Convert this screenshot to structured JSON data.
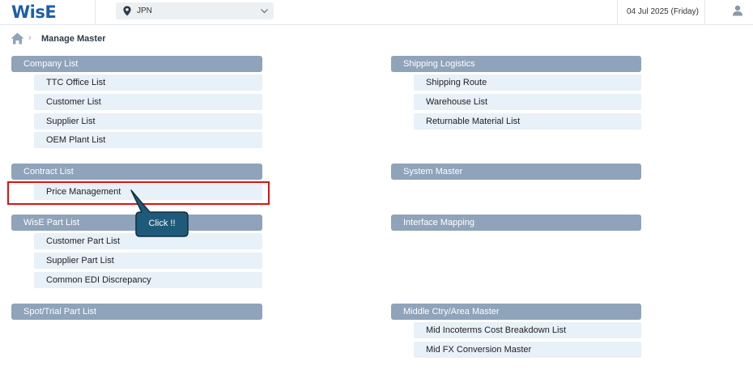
{
  "header": {
    "logo": "WisE",
    "country": "JPN",
    "date": "04 Jul 2025 (Friday)"
  },
  "breadcrumb": {
    "title": "Manage Master"
  },
  "groups": {
    "company_list": {
      "title": "Company List",
      "items": [
        "TTC Office List",
        "Customer List",
        "Supplier List",
        "OEM Plant List"
      ]
    },
    "contract_list": {
      "title": "Contract List",
      "items": [
        "Price Management"
      ]
    },
    "wise_part_list": {
      "title": "WisE Part List",
      "items": [
        "Customer Part List",
        "Supplier Part List",
        "Common EDI Discrepancy"
      ]
    },
    "spot_trial_part_list": {
      "title": "Spot/Trial Part List",
      "items": []
    },
    "shipping_logistics": {
      "title": "Shipping Logistics",
      "items": [
        "Shipping Route",
        "Warehouse List",
        "Returnable Material List"
      ]
    },
    "system_master": {
      "title": "System Master",
      "items": []
    },
    "interface_mapping": {
      "title": "Interface Mapping",
      "items": []
    },
    "middle_ctry_area_master": {
      "title": "Middle Ctry/Area Master",
      "items": [
        "Mid Incoterms Cost Breakdown List",
        "Mid FX Conversion Master"
      ]
    }
  },
  "callout": {
    "text": "Click !!"
  },
  "colors": {
    "brand": "#1f5fa8",
    "group_header": "#8fa3ba",
    "item_bg": "#e8f0f8",
    "highlight": "#e01010",
    "callout": "#1f5a7a"
  }
}
